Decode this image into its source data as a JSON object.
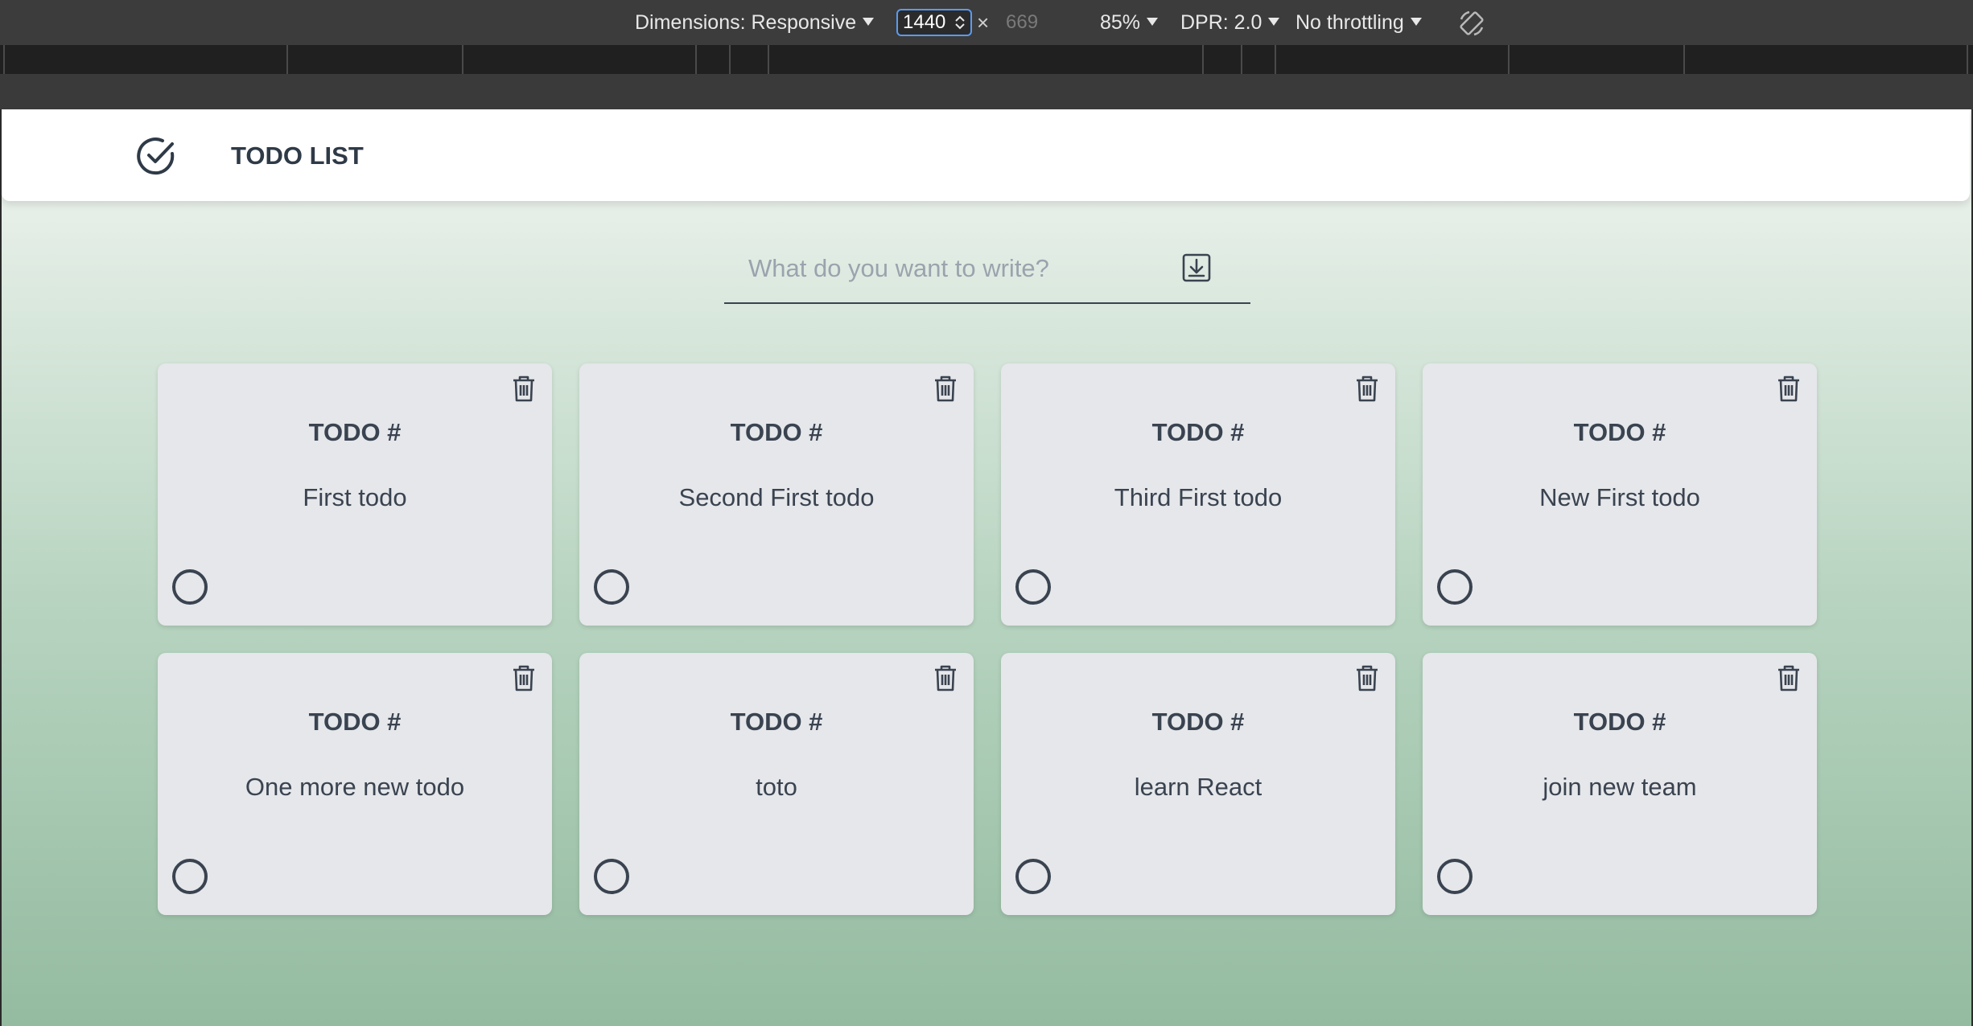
{
  "devtools": {
    "dimensions_label": "Dimensions: Responsive",
    "width_value": "1440",
    "times_symbol": "×",
    "height_value": "669",
    "zoom_label": "85%",
    "dpr_label": "DPR: 2.0",
    "throttling_label": "No throttling",
    "rotate_icon": "rotate-icon"
  },
  "app": {
    "title": "TODO LIST",
    "logo_icon": "check-circle-icon"
  },
  "search": {
    "placeholder": "What do you want to write?",
    "value": "",
    "save_icon": "save-download-icon"
  },
  "todos": [
    {
      "heading": "TODO #",
      "text": "First todo"
    },
    {
      "heading": "TODO #",
      "text": "Second First todo"
    },
    {
      "heading": "TODO #",
      "text": "Third First todo"
    },
    {
      "heading": "TODO #",
      "text": "New First todo"
    },
    {
      "heading": "TODO #",
      "text": "One more new todo"
    },
    {
      "heading": "TODO #",
      "text": "toto"
    },
    {
      "heading": "TODO #",
      "text": "learn React"
    },
    {
      "heading": "TODO #",
      "text": "join new team"
    }
  ],
  "colors": {
    "text": "#3a4350",
    "card_bg": "#e5e7ea",
    "toolbar_bg": "#3c3c3c",
    "focus_accent": "#5a9bf0"
  }
}
